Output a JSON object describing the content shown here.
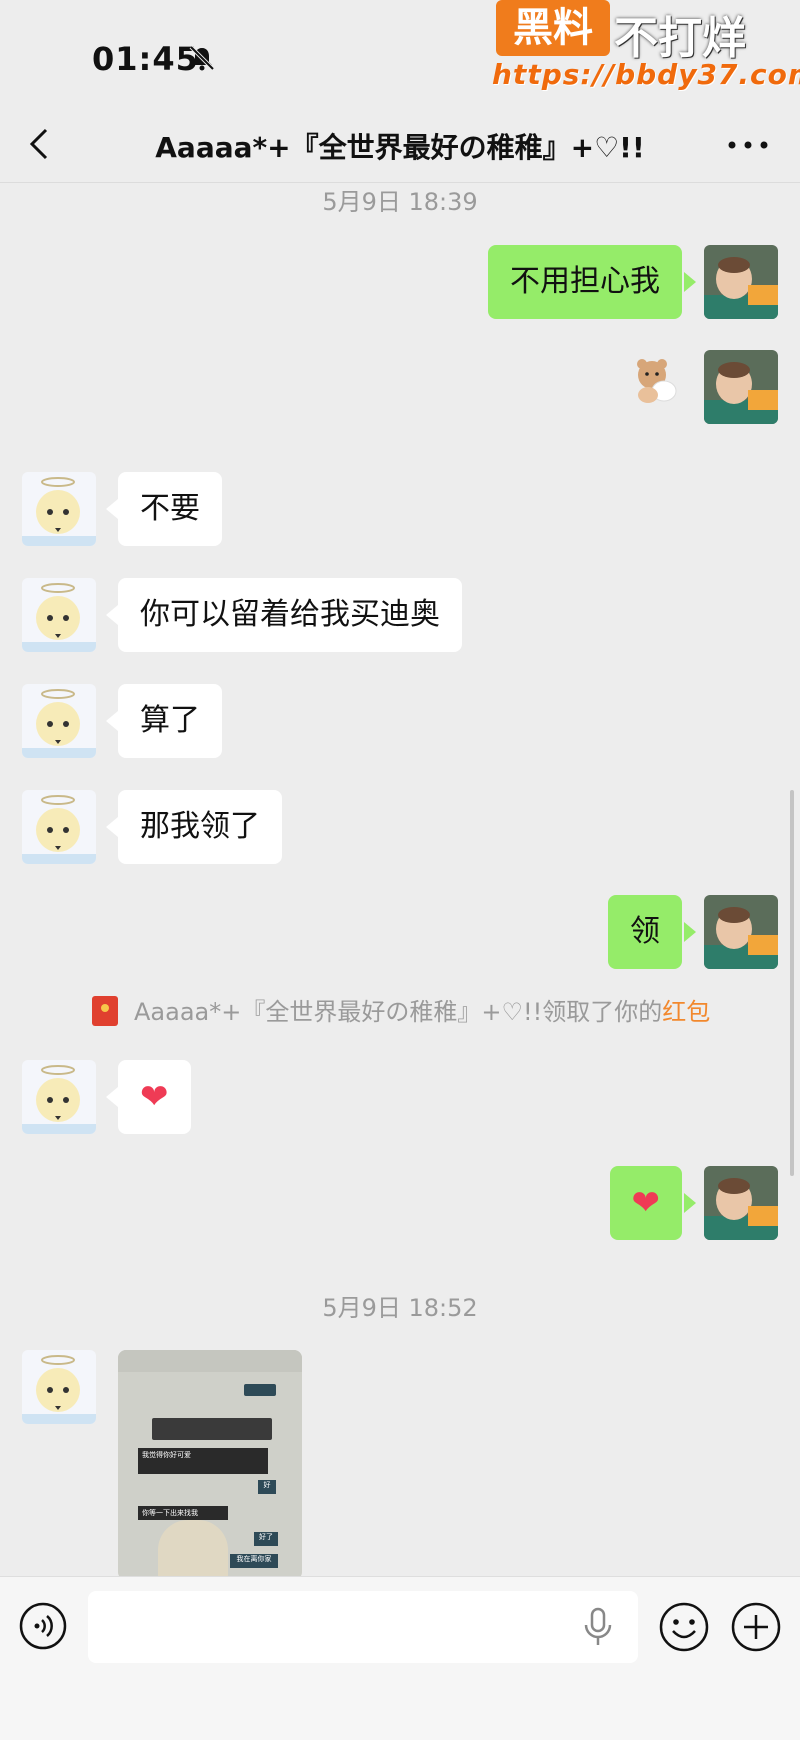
{
  "status": {
    "time": "01:45"
  },
  "watermark": {
    "brand": "黑料",
    "text": "不打烊",
    "url": "https://bbdy37.com"
  },
  "header": {
    "title": "Aaaaa*+『全世界最好の稚稚』+♡!!"
  },
  "timestamps": [
    "5月9日 18:39",
    "5月9日 18:52"
  ],
  "messages": [
    {
      "from": "me",
      "text": "不用担心我"
    },
    {
      "from": "me",
      "type": "sticker",
      "sticker": "bear-sticker"
    },
    {
      "from": "them",
      "text": "不要"
    },
    {
      "from": "them",
      "text": "你可以留着给我买迪奥"
    },
    {
      "from": "them",
      "text": "算了"
    },
    {
      "from": "them",
      "text": "那我领了"
    },
    {
      "from": "me",
      "text": "领"
    },
    {
      "from": "them",
      "type": "emoji",
      "text": "❤"
    },
    {
      "from": "me",
      "type": "emoji",
      "text": "❤"
    }
  ],
  "system": {
    "prefix": "Aaaaa*+『全世界最好の稚稚』+♡!!领取了你的",
    "link": "红包"
  },
  "thumbnail": {
    "lines": [
      "我觉得你好可爱",
      "我最喜欢你",
      "我要去吃饭了",
      "好",
      "你等一下出来找我",
      "好了",
      "我在离你家"
    ]
  },
  "input": {
    "placeholder": ""
  },
  "icons": {
    "back": "chevron-left-icon",
    "more": "more-icon",
    "voice": "voice-icon",
    "mic": "mic-icon",
    "emoji": "emoji-icon",
    "plus": "plus-icon",
    "bell": "bell-off-icon",
    "redpacket": "red-packet-icon"
  },
  "colors": {
    "bubble_out": "#95ec69",
    "bubble_in": "#ffffff",
    "background": "#ededed",
    "link": "#f2882d"
  }
}
